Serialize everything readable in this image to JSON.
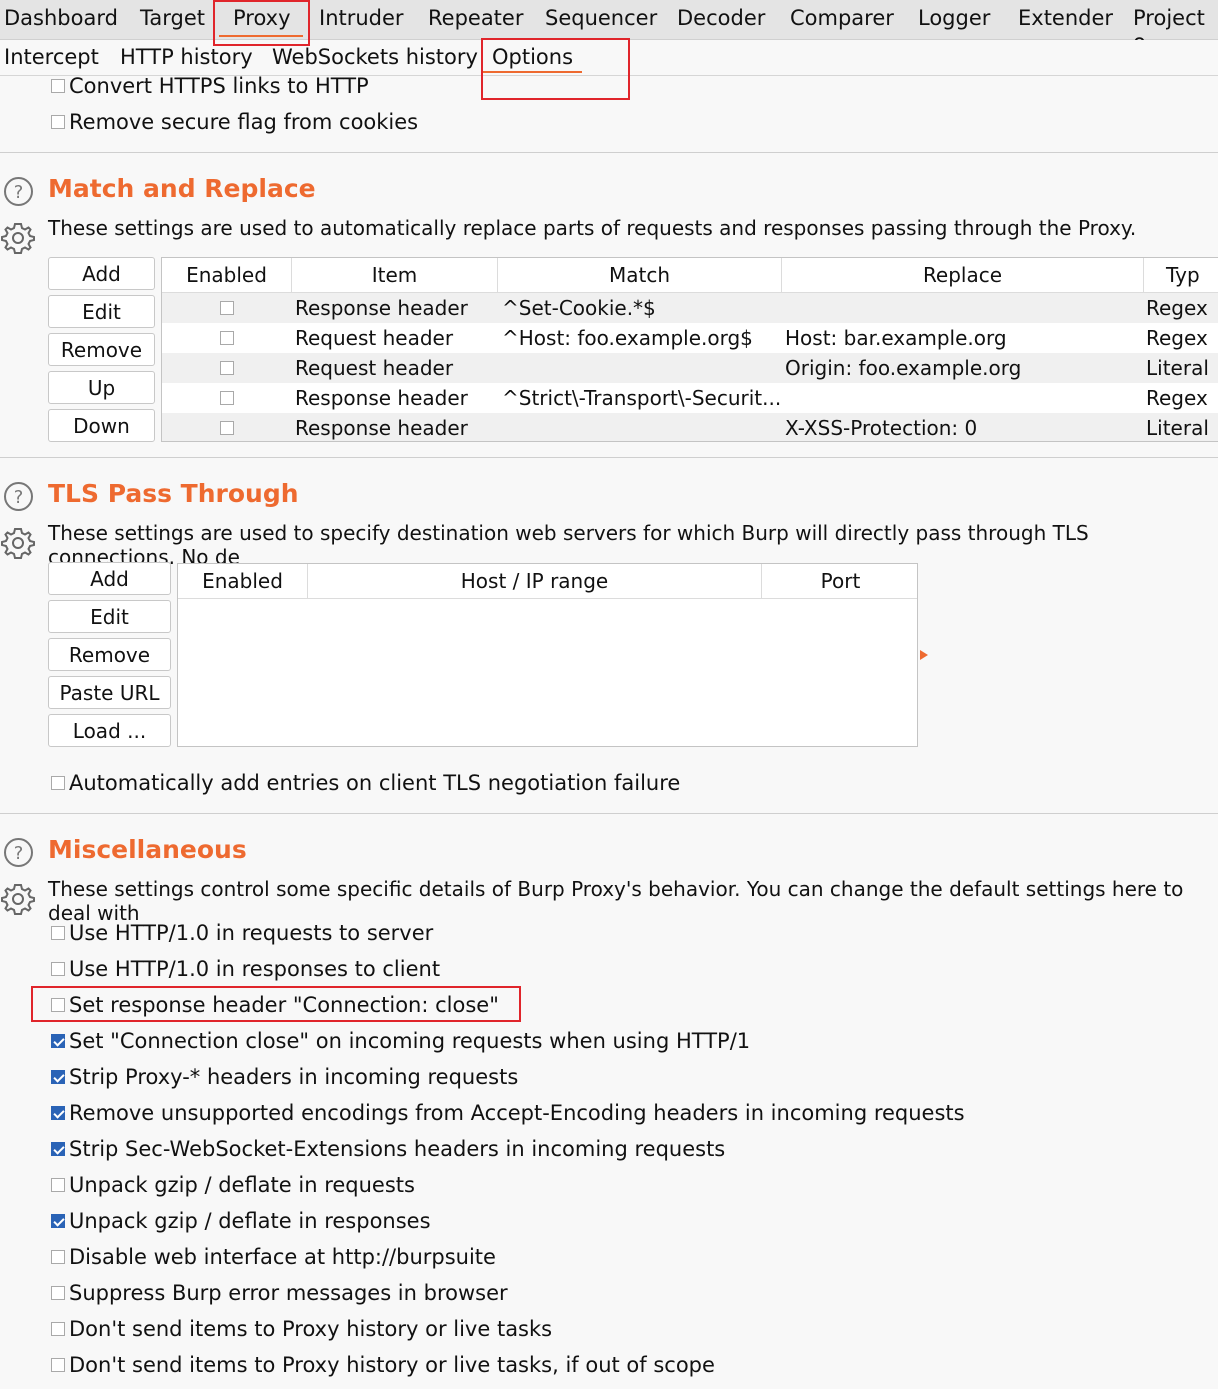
{
  "main_tabs": [
    "Dashboard",
    "Target",
    "Proxy",
    "Intruder",
    "Repeater",
    "Sequencer",
    "Decoder",
    "Comparer",
    "Logger",
    "Extender",
    "Project o"
  ],
  "sub_tabs": [
    "Intercept",
    "HTTP history",
    "WebSockets history",
    "Options"
  ],
  "top_options": [
    {
      "label": "Convert HTTPS links to HTTP",
      "checked": false
    },
    {
      "label": "Remove secure flag from cookies",
      "checked": false
    }
  ],
  "match_replace": {
    "title": "Match and Replace",
    "description": "These settings are used to automatically replace parts of requests and responses passing through the Proxy.",
    "buttons": [
      "Add",
      "Edit",
      "Remove",
      "Up",
      "Down"
    ],
    "columns": [
      "Enabled",
      "Item",
      "Match",
      "Replace",
      "Typ"
    ],
    "rows": [
      {
        "enabled": false,
        "item": "Response header",
        "match": "^Set-Cookie.*$",
        "replace": "",
        "type": "Regex"
      },
      {
        "enabled": false,
        "item": "Request header",
        "match": "^Host: foo.example.org$",
        "replace": "Host: bar.example.org",
        "type": "Regex"
      },
      {
        "enabled": false,
        "item": "Request header",
        "match": "",
        "replace": "Origin: foo.example.org",
        "type": "Literal"
      },
      {
        "enabled": false,
        "item": "Response header",
        "match": "^Strict\\-Transport\\-Securit...",
        "replace": "",
        "type": "Regex"
      },
      {
        "enabled": false,
        "item": "Response header",
        "match": "",
        "replace": "X-XSS-Protection: 0",
        "type": "Literal"
      }
    ]
  },
  "tls": {
    "title": "TLS Pass Through",
    "description": "These settings are used to specify destination web servers for which Burp will directly pass through TLS connections. No de",
    "buttons": [
      "Add",
      "Edit",
      "Remove",
      "Paste URL",
      "Load ..."
    ],
    "columns": [
      "Enabled",
      "Host / IP range",
      "Port"
    ],
    "auto_add": {
      "label": "Automatically add entries on client TLS negotiation failure",
      "checked": false
    }
  },
  "misc": {
    "title": "Miscellaneous",
    "description": "These settings control some specific details of Burp Proxy's behavior. You can change the default settings here to deal with",
    "options": [
      {
        "label": "Use HTTP/1.0 in requests to server",
        "checked": false
      },
      {
        "label": "Use HTTP/1.0 in responses to client",
        "checked": false
      },
      {
        "label": "Set response header \"Connection: close\"",
        "checked": false
      },
      {
        "label": "Set \"Connection close\" on incoming requests when using HTTP/1",
        "checked": true
      },
      {
        "label": "Strip Proxy-* headers in incoming requests",
        "checked": true
      },
      {
        "label": "Remove unsupported encodings from Accept-Encoding headers in incoming requests",
        "checked": true
      },
      {
        "label": "Strip Sec-WebSocket-Extensions headers in incoming requests",
        "checked": true
      },
      {
        "label": "Unpack gzip / deflate in requests",
        "checked": false
      },
      {
        "label": "Unpack gzip / deflate in responses",
        "checked": true
      },
      {
        "label": "Disable web interface at http://burpsuite",
        "checked": false
      },
      {
        "label": "Suppress Burp error messages in browser",
        "checked": false
      },
      {
        "label": "Don't send items to Proxy history or live tasks",
        "checked": false
      },
      {
        "label": "Don't send items to Proxy history or live tasks, if out of scope",
        "checked": false
      }
    ]
  },
  "colors": {
    "accent": "#ee6a30",
    "highlight_box": "#e0252b",
    "checkbox_checked": "#2a63b6"
  }
}
